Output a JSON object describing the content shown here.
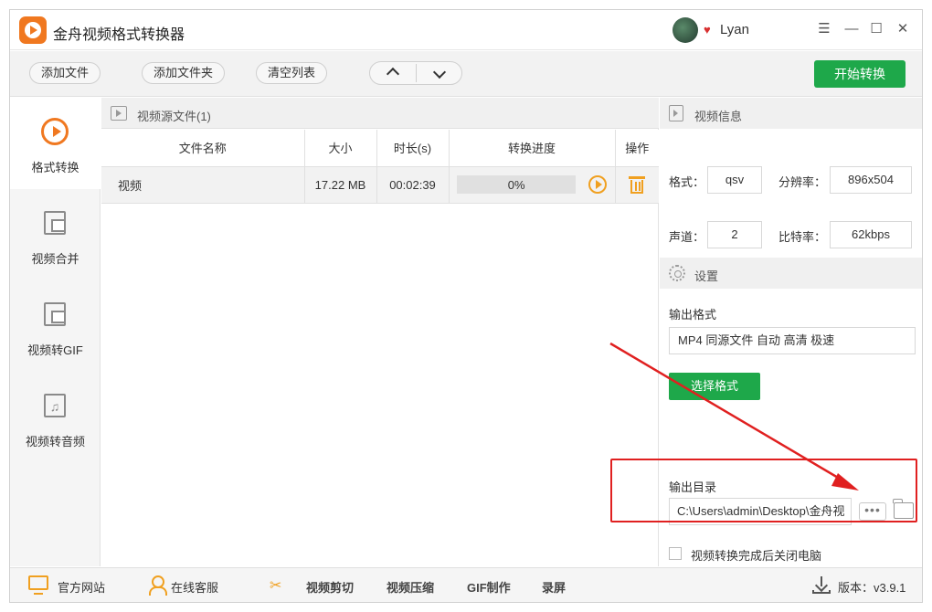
{
  "app": {
    "title": "金舟视频格式转换器",
    "username": "Lyan"
  },
  "toolbar": {
    "add_file": "添加文件",
    "add_folder": "添加文件夹",
    "clear_list": "清空列表",
    "start": "开始转换"
  },
  "sidebar": {
    "items": [
      {
        "label": "格式转换",
        "icon": "convert-icon",
        "active": true
      },
      {
        "label": "视频合并",
        "icon": "merge-icon"
      },
      {
        "label": "视频转GIF",
        "icon": "image-icon"
      },
      {
        "label": "视频转音频",
        "icon": "music-icon"
      }
    ]
  },
  "filelist": {
    "header": "视频源文件(1)",
    "columns": [
      "文件名称",
      "大小",
      "时长(s)",
      "转换进度",
      "操作"
    ],
    "rows": [
      {
        "name": "视频",
        "size": "17.22 MB",
        "duration": "00:02:39",
        "progress_text": "0%",
        "progress": 0
      }
    ]
  },
  "info": {
    "header": "视频信息",
    "format_label": "格式：",
    "format_value": "qsv",
    "resolution_label": "分辨率：",
    "resolution_value": "896x504",
    "channel_label": "声道：",
    "channel_value": "2",
    "bitrate_label": "比特率：",
    "bitrate_value": "62kbps"
  },
  "settings": {
    "header": "设置",
    "output_format_label": "输出格式",
    "output_format_value": "MP4  同源文件  自动  高清  极速",
    "choose_format": "选择格式",
    "output_dir_label": "输出目录",
    "output_dir_value": "C:\\Users\\admin\\Desktop\\金舟视",
    "more_label": "•••",
    "shutdown_label": "视频转换完成后关闭电脑",
    "shutdown_checked": false
  },
  "footer": {
    "website": "官方网站",
    "support": "在线客服",
    "cut": "视频剪切",
    "compress": "视频压缩",
    "gif": "GIF制作",
    "record": "录屏",
    "version": "版本：v3.9.1"
  },
  "colors": {
    "accent": "#1ea84a",
    "orange": "#f07820",
    "annotation": "#e02020"
  }
}
